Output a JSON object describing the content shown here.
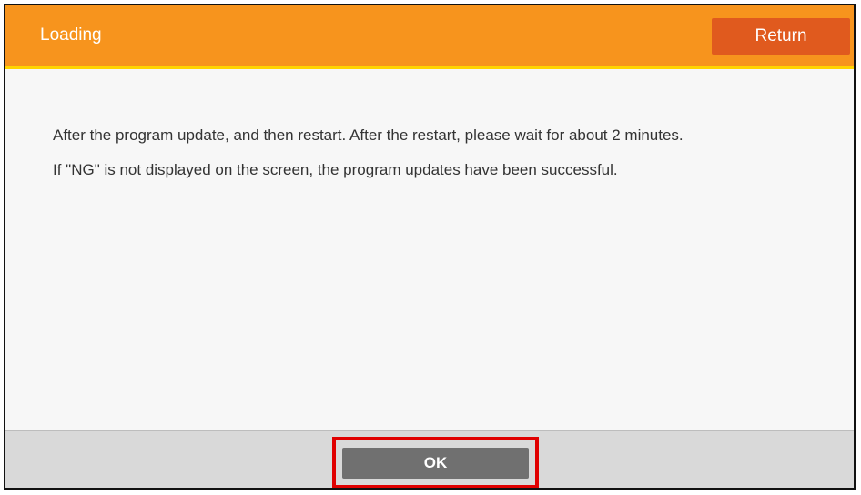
{
  "dialog": {
    "title": "Loading",
    "return_label": "Return",
    "message_line1": "After the program update, and then restart. After the restart, please wait for about 2 minutes.",
    "message_line2": "If \"NG\" is not displayed on the screen, the program updates have been successful.",
    "ok_label": "OK"
  },
  "colors": {
    "header": "#f7941d",
    "header_underline": "#ffd400",
    "return_button": "#e05a1e",
    "ok_button": "#707070",
    "highlight": "#e00000"
  }
}
